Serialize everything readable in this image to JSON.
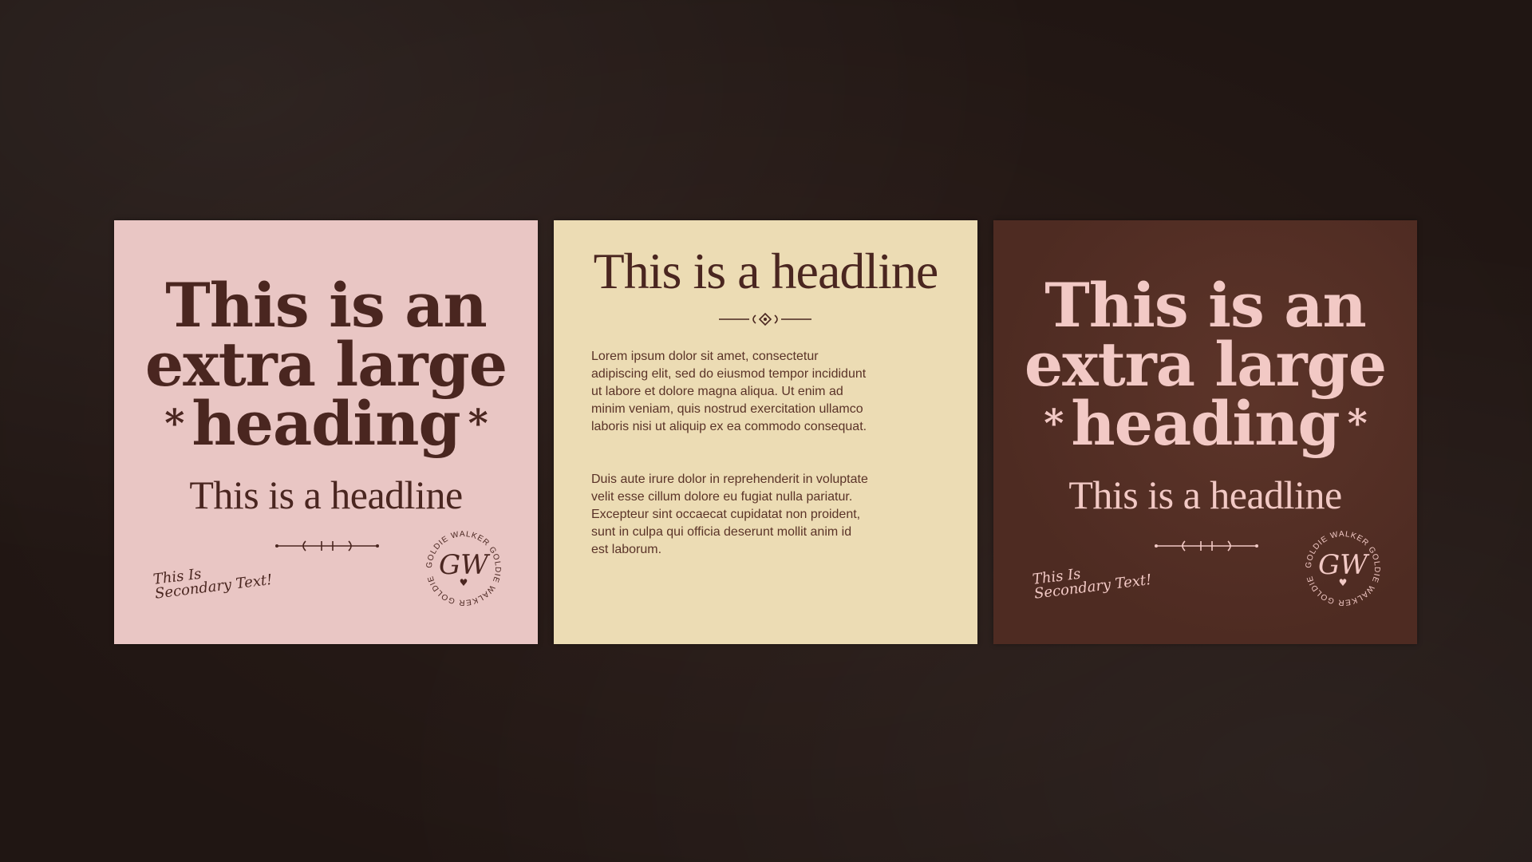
{
  "colors": {
    "background": "#2b1d19",
    "pink": "#e9c6c4",
    "cream": "#ecdcb4",
    "brown": "#4e2b22",
    "dark_text": "#4a2620",
    "light_text": "#f2c9c5"
  },
  "card_pink": {
    "heading_lines": [
      "This is an",
      "extra large",
      "heading"
    ],
    "heading_ornament": "*",
    "headline": "This is a headline",
    "secondary_lines": [
      "This Is",
      "Secondary Text!"
    ],
    "seal_ring_text": "GOLDIE WALKER GOLDIE WALKER GOLDIE WALKER",
    "seal_monogram": "GW",
    "seal_heart": "♥"
  },
  "card_cream": {
    "headline": "This is a headline",
    "paragraph_1": "Lorem ipsum dolor sit amet, consectetur adipiscing elit, sed do eiusmod tempor incididunt ut labore et dolore magna aliqua. Ut enim ad minim veniam, quis nostrud exercitation ullamco laboris nisi ut aliquip ex ea commodo consequat.",
    "paragraph_2": "Duis aute irure dolor in reprehenderit in voluptate velit esse cillum dolore eu fugiat nulla pariatur. Excepteur sint occaecat cupidatat non proident, sunt in culpa qui officia deserunt mollit anim id est laborum."
  },
  "card_brown": {
    "heading_lines": [
      "This is an",
      "extra large",
      "heading"
    ],
    "heading_ornament": "*",
    "headline": "This is a headline",
    "secondary_lines": [
      "This Is",
      "Secondary Text!"
    ],
    "seal_ring_text": "GOLDIE WALKER GOLDIE WALKER GOLDIE WALKER",
    "seal_monogram": "GW",
    "seal_heart": "♥"
  }
}
